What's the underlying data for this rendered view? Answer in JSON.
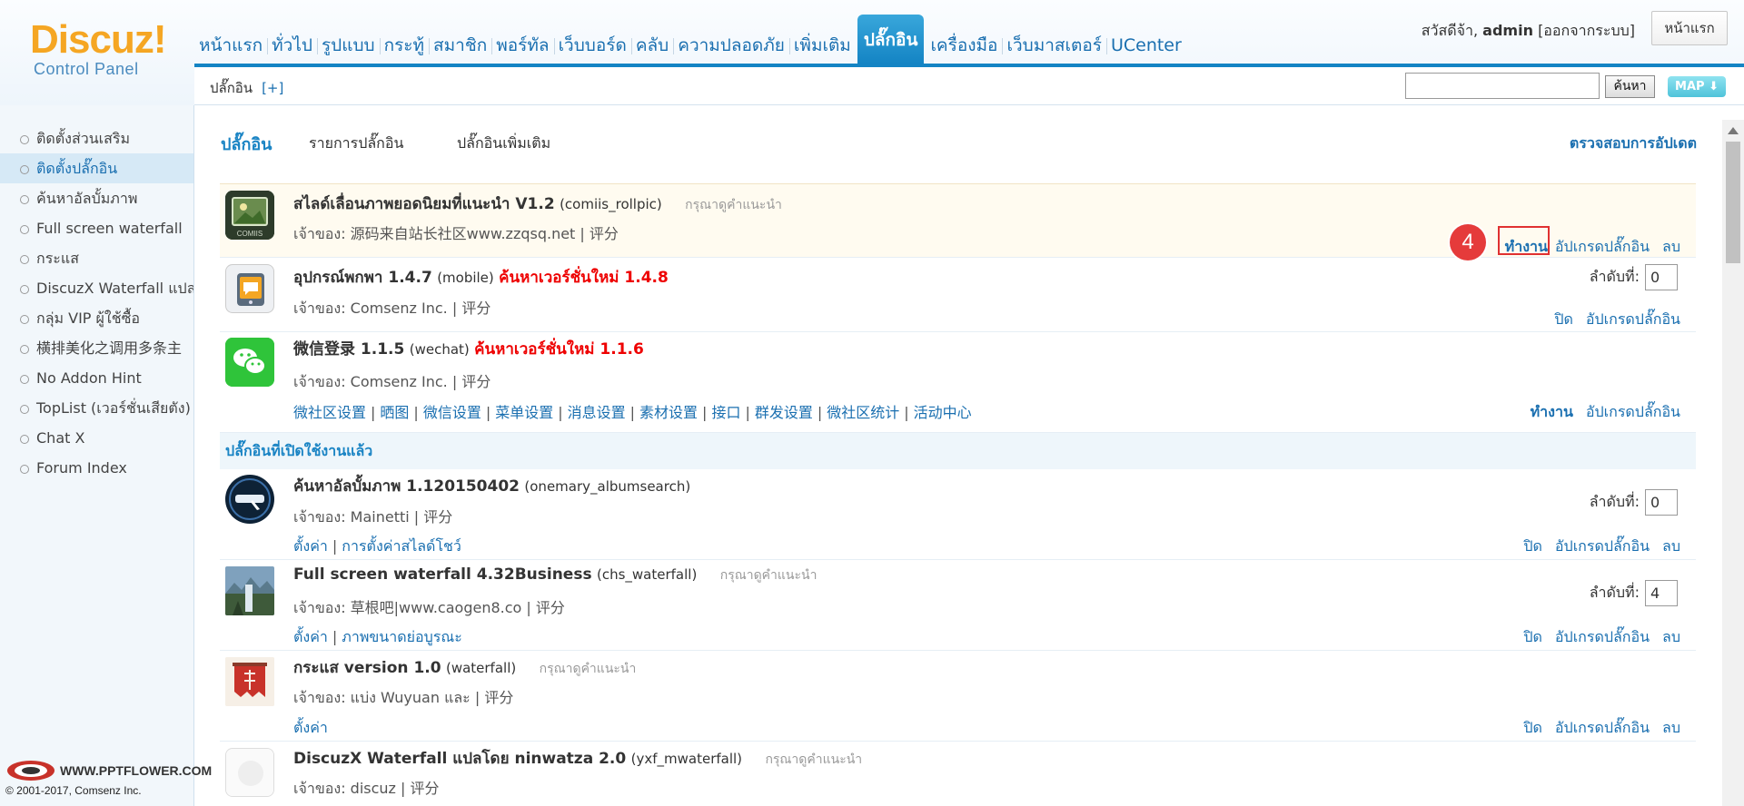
{
  "logo": {
    "brand": "Discuz!",
    "sub": "Control Panel"
  },
  "topnav": [
    {
      "label": "หน้าแรก"
    },
    {
      "label": "ทั่วไป"
    },
    {
      "label": "รูปแบบ"
    },
    {
      "label": "กระทู้"
    },
    {
      "label": "สมาชิก"
    },
    {
      "label": "พอร์ทัล"
    },
    {
      "label": "เว็บบอร์ด"
    },
    {
      "label": "คลับ"
    },
    {
      "label": "ความปลอดภัย"
    },
    {
      "label": "เพิ่มเติม"
    },
    {
      "label": "ปลั๊กอิน",
      "active": true
    },
    {
      "label": "เครื่องมือ"
    },
    {
      "label": "เว็บมาสเตอร์"
    },
    {
      "label": "UCenter"
    }
  ],
  "user": {
    "greeting": "สวัสดีจ้า,",
    "name": "admin",
    "logout": "[ออกจากระบบ]"
  },
  "home_button": "หน้าแรก",
  "subbar": {
    "breadcrumb": "ปลั๊กอิน",
    "add": "[+]",
    "search_button": "ค้นหา",
    "map_button": "MAP ⬇"
  },
  "sidebar": {
    "items": [
      {
        "label": "ติดตั้งส่วนเสริม"
      },
      {
        "label": "ติดตั้งปลั๊กอิน",
        "active": true
      },
      {
        "label": "ค้นหาอัลบั้มภาพ"
      },
      {
        "label": "Full screen waterfall"
      },
      {
        "label": "กระแส"
      },
      {
        "label": "DiscuzX Waterfall แปล"
      },
      {
        "label": "กลุ่ม VIP ผู้ใช้ซื้อ"
      },
      {
        "label": "横排美化之调用多条主"
      },
      {
        "label": "No Addon Hint"
      },
      {
        "label": "TopList (เวอร์ชั่นเสียตัง)"
      },
      {
        "label": "Chat X"
      },
      {
        "label": "Forum Index"
      }
    ]
  },
  "tabs": {
    "current": "ปลั๊กอิน",
    "list": "รายการปลั๊กอิน",
    "more": "ปลั๊กอินเพิ่มเติม",
    "check_update": "ตรวจสอบการอัปเดต"
  },
  "section_enabled": "ปลั๊กอินที่เปิดใช้งานแล้ว",
  "order_label": "ลำดับที่:",
  "plugins": [
    {
      "name": "สไลด์เลื่อนภาพยอดนิยมที่แนะนำ V1.2",
      "id": "(comiis_rollpic)",
      "hint": "กรุณาดูคำแนะนำ",
      "author": "เจ้าของ: 源码来自站长社区www.zzqsq.net | 评分",
      "actions": [
        "ทำงาน",
        "อัปเกรดปลั๊กอิน",
        "ลบ"
      ],
      "icon": "comiis-icon"
    },
    {
      "name": "อุปกรณ์พกพา 1.4.7",
      "id": "(mobile)",
      "new_version": "ค้นหาเวอร์ชั่นใหม่ 1.4.8",
      "author": "เจ้าของ: Comsenz Inc. | 评分",
      "order": "0",
      "actions": [
        "ปิด",
        "อัปเกรดปลั๊กอิน"
      ],
      "icon": "mobile-icon"
    },
    {
      "name": "微信登录 1.1.5",
      "id": "(wechat)",
      "new_version": "ค้นหาเวอร์ชั่นใหม่ 1.1.6",
      "author": "เจ้าของ: Comsenz Inc. | 评分",
      "links": [
        "微社区设置",
        "晒图",
        "微信设置",
        "菜单设置",
        "消息设置",
        "素材设置",
        "接口",
        "群发设置",
        "微社区统计",
        "活动中心"
      ],
      "actions": [
        "ทำงาน",
        "อัปเกรดปลั๊กอิน"
      ],
      "icon": "wechat-icon"
    },
    {
      "name": "ค้นหาอัลบั้มภาพ 1.120150402",
      "id": "(onemary_albumsearch)",
      "author": "เจ้าของ: Mainetti | 评分",
      "order": "0",
      "links": [
        "ตั้งค่า",
        "การตั้งค่าสไลด์โชว์"
      ],
      "actions": [
        "ปิด",
        "อัปเกรดปลั๊กอิน",
        "ลบ"
      ],
      "icon": "album-search-icon"
    },
    {
      "name": "Full screen waterfall 4.32Business",
      "id": "(chs_waterfall)",
      "hint": "กรุณาดูคำแนะนำ",
      "author": "เจ้าของ: 草根吧|www.caogen8.co | 评分",
      "order": "4",
      "links": [
        "ตั้งค่า",
        "ภาพขนาดย่อบูรณะ"
      ],
      "actions": [
        "ปิด",
        "อัปเกรดปลั๊กอิน",
        "ลบ"
      ],
      "icon": "waterfall-photo-icon"
    },
    {
      "name": "กระแส version 1.0",
      "id": "(waterfall)",
      "hint": "กรุณาดูคำแนะนำ",
      "author": "เจ้าของ: แบ่ง Wuyuan และ | 评分",
      "links": [
        "ตั้งค่า"
      ],
      "actions": [
        "ปิด",
        "อัปเกรดปลั๊กอิน",
        "ลบ"
      ],
      "icon": "red-banner-icon"
    },
    {
      "name": "DiscuzX Waterfall แปลโดย ninwatza 2.0",
      "id": "(yxf_mwaterfall)",
      "hint": "กรุณาดูคำแนะนำ",
      "author": "เจ้าของ: discuz | 评分",
      "icon": "blank-icon"
    }
  ],
  "annotation": {
    "step": "4"
  },
  "watermark": {
    "site": "WWW.PPTFLOWER.COM",
    "copyright": "© 2001-2017, Comsenz Inc."
  },
  "colors": {
    "accent": "#1484c4",
    "link": "#1a6fb0",
    "new_version": "#ee0000",
    "highlight_box": "#e03131"
  }
}
